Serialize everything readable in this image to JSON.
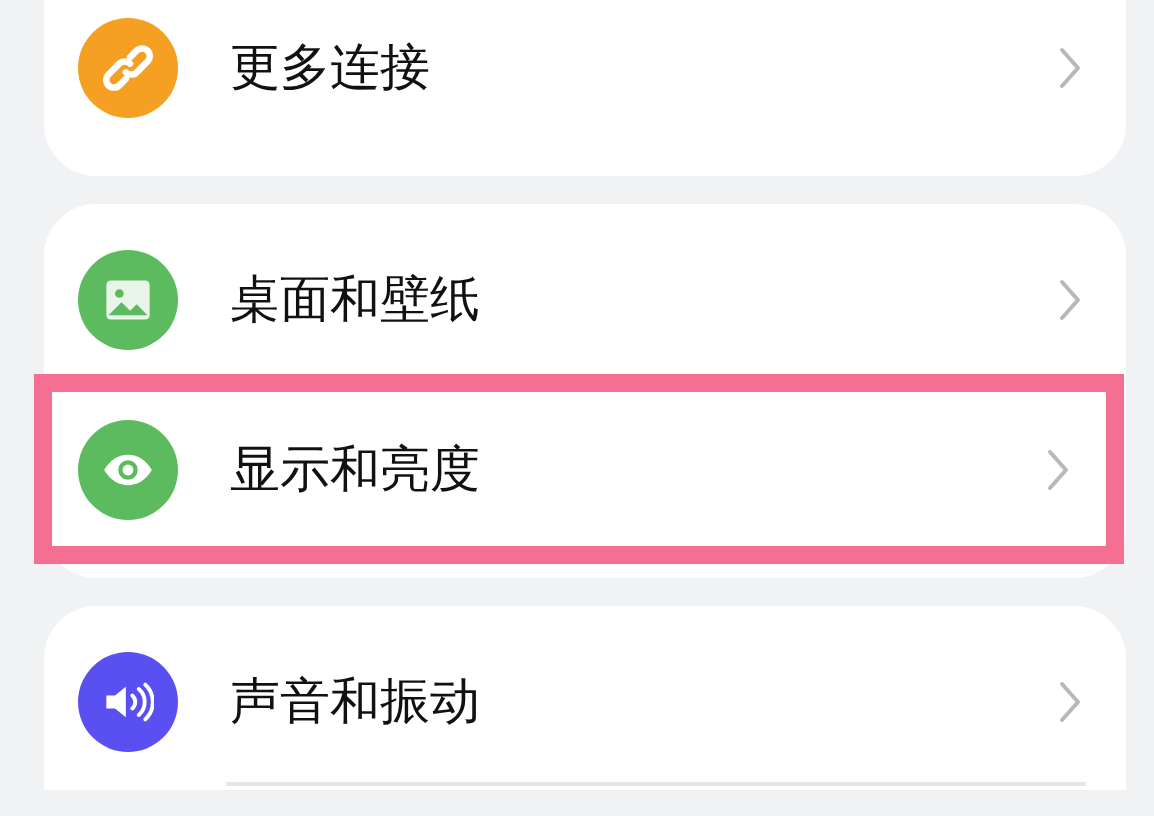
{
  "groups": [
    {
      "cut_above": true,
      "items": [
        {
          "label": "更多连接",
          "kind": "link",
          "color": "#f5a023",
          "highlighted": false
        }
      ]
    },
    {
      "items": [
        {
          "label": "桌面和壁纸",
          "kind": "picture",
          "color": "#5cbb5f",
          "highlighted": false
        },
        {
          "label": "显示和亮度",
          "kind": "eye",
          "color": "#5cbb5f",
          "highlighted": true
        }
      ]
    },
    {
      "cut_below": true,
      "items": [
        {
          "label": "声音和振动",
          "kind": "speaker",
          "color": "#5a4ff0",
          "highlighted": false
        }
      ]
    }
  ]
}
